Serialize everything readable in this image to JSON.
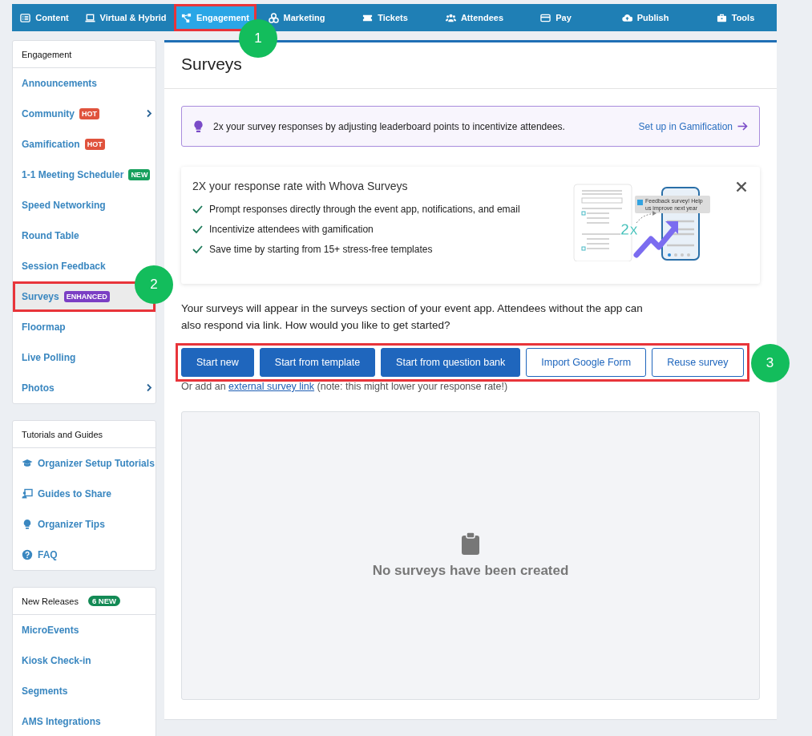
{
  "nav": {
    "tabs": [
      {
        "label": "Content",
        "selected": false,
        "highlighted": false
      },
      {
        "label": "Virtual & Hybrid",
        "selected": false,
        "highlighted": false
      },
      {
        "label": "Engagement",
        "selected": true,
        "highlighted": true,
        "callout": "1"
      },
      {
        "label": "Marketing",
        "selected": false,
        "highlighted": false
      },
      {
        "label": "Tickets",
        "selected": false,
        "highlighted": false
      },
      {
        "label": "Attendees",
        "selected": false,
        "highlighted": false
      },
      {
        "label": "Pay",
        "selected": false,
        "highlighted": false
      },
      {
        "label": "Publish",
        "selected": false,
        "highlighted": false
      },
      {
        "label": "Tools",
        "selected": false,
        "highlighted": false
      }
    ]
  },
  "sidebar": {
    "engagement": {
      "title": "Engagement",
      "items": [
        {
          "label": "Announcements",
          "selected": false,
          "expandable": false
        },
        {
          "label": "Community",
          "badge": {
            "text": "HOT",
            "color": "#e0533d"
          },
          "selected": false,
          "expandable": true
        },
        {
          "label": "Gamification",
          "badge": {
            "text": "HOT",
            "color": "#e0533d"
          },
          "selected": false,
          "expandable": false
        },
        {
          "label": "1-1 Meeting Scheduler",
          "badge": {
            "text": "NEW",
            "color": "#17a05d"
          },
          "selected": false,
          "expandable": false
        },
        {
          "label": "Speed Networking",
          "selected": false,
          "expandable": false
        },
        {
          "label": "Round Table",
          "selected": false,
          "expandable": false
        },
        {
          "label": "Session Feedback",
          "selected": false,
          "expandable": false
        },
        {
          "label": "Surveys",
          "badge": {
            "text": "ENHANCED",
            "color": "#7b3fc4"
          },
          "selected": true,
          "expandable": false,
          "highlighted": true,
          "callout": "2"
        },
        {
          "label": "Floormap",
          "selected": false,
          "expandable": false
        },
        {
          "label": "Live Polling",
          "selected": false,
          "expandable": false
        },
        {
          "label": "Photos",
          "selected": false,
          "expandable": true
        }
      ]
    },
    "tutorials": {
      "title": "Tutorials and Guides",
      "items": [
        {
          "label": "Organizer Setup Tutorials"
        },
        {
          "label": "Guides to Share"
        },
        {
          "label": "Organizer Tips"
        },
        {
          "label": "FAQ"
        }
      ]
    },
    "new_releases": {
      "title": "New Releases",
      "badge": "6 NEW",
      "items": [
        {
          "label": "MicroEvents"
        },
        {
          "label": "Kiosk Check-in"
        },
        {
          "label": "Segments"
        },
        {
          "label": "AMS Integrations"
        }
      ]
    }
  },
  "main": {
    "title": "Surveys",
    "banner": {
      "text": "2x your survey responses by adjusting leaderboard points to incentivize attendees.",
      "link": "Set up in Gamification"
    },
    "promo": {
      "title": "2X your response rate with Whova Surveys",
      "points": [
        "Prompt responses directly through the event app, notifications, and email",
        "Incentivize attendees with gamification",
        "Save time by starting from 15+ stress-free templates"
      ],
      "illustration": {
        "multiplier": "2x",
        "notification": "Feedback survey! Help us improve next year"
      }
    },
    "intro": "Your surveys will appear in the surveys section of your event app. Attendees without the app can also respond via link. How would you like to get started?",
    "actions": {
      "highlighted": true,
      "callout": "3",
      "buttons": [
        {
          "label": "Start new",
          "kind": "primary"
        },
        {
          "label": "Start from template",
          "kind": "primary"
        },
        {
          "label": "Start from question bank",
          "kind": "primary"
        },
        {
          "label": "Import Google Form",
          "kind": "outline"
        },
        {
          "label": "Reuse survey",
          "kind": "outline"
        }
      ]
    },
    "external": {
      "before": "Or add an",
      "link": "external survey link",
      "after": "(note: this might lower your response rate!)"
    },
    "empty_state": {
      "message": "No surveys have been created"
    }
  }
}
